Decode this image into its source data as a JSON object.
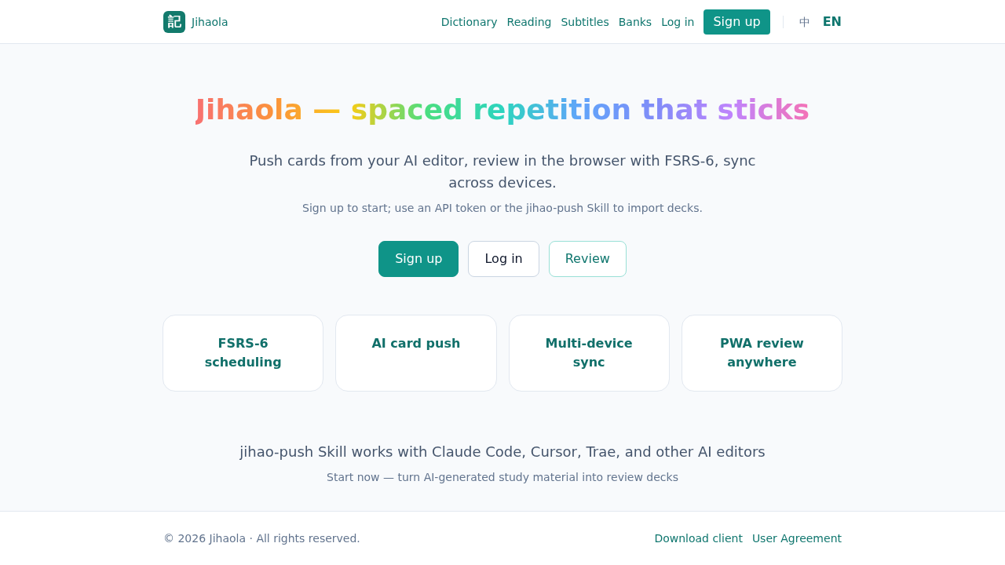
{
  "header": {
    "logo": {
      "mark": "記",
      "name": "Jihaola"
    },
    "nav_links": [
      "Dictionary",
      "Reading",
      "Subtitles",
      "Banks",
      "Log in"
    ],
    "signup_button": "Sign up",
    "languages": [
      {
        "label": "中",
        "selected": false
      },
      {
        "label": "EN",
        "selected": true
      }
    ]
  },
  "hero": {
    "title": "Jihaola — spaced repetition that sticks",
    "subtitle": "Push cards from your AI editor, review in the browser with FSRS-6, sync across devices.",
    "note": "Sign up to start; use an API token or the jihao-push Skill to import decks.",
    "buttons": [
      {
        "label": "Sign up",
        "kind": "primary"
      },
      {
        "label": "Log in",
        "kind": "secondary"
      },
      {
        "label": "Review",
        "kind": "outline"
      }
    ]
  },
  "features": [
    "FSRS-6 scheduling",
    "AI card push",
    "Multi-device sync",
    "PWA review anywhere"
  ],
  "integrations": {
    "headline": "jihao-push Skill works with Claude Code, Cursor, Trae, and other AI editors",
    "tagline": "Start now — turn AI-generated study material into review decks"
  },
  "footer": {
    "copyright": "© 2026 Jihaola · All rights reserved.",
    "links": [
      "Download client",
      "User Agreement"
    ]
  }
}
